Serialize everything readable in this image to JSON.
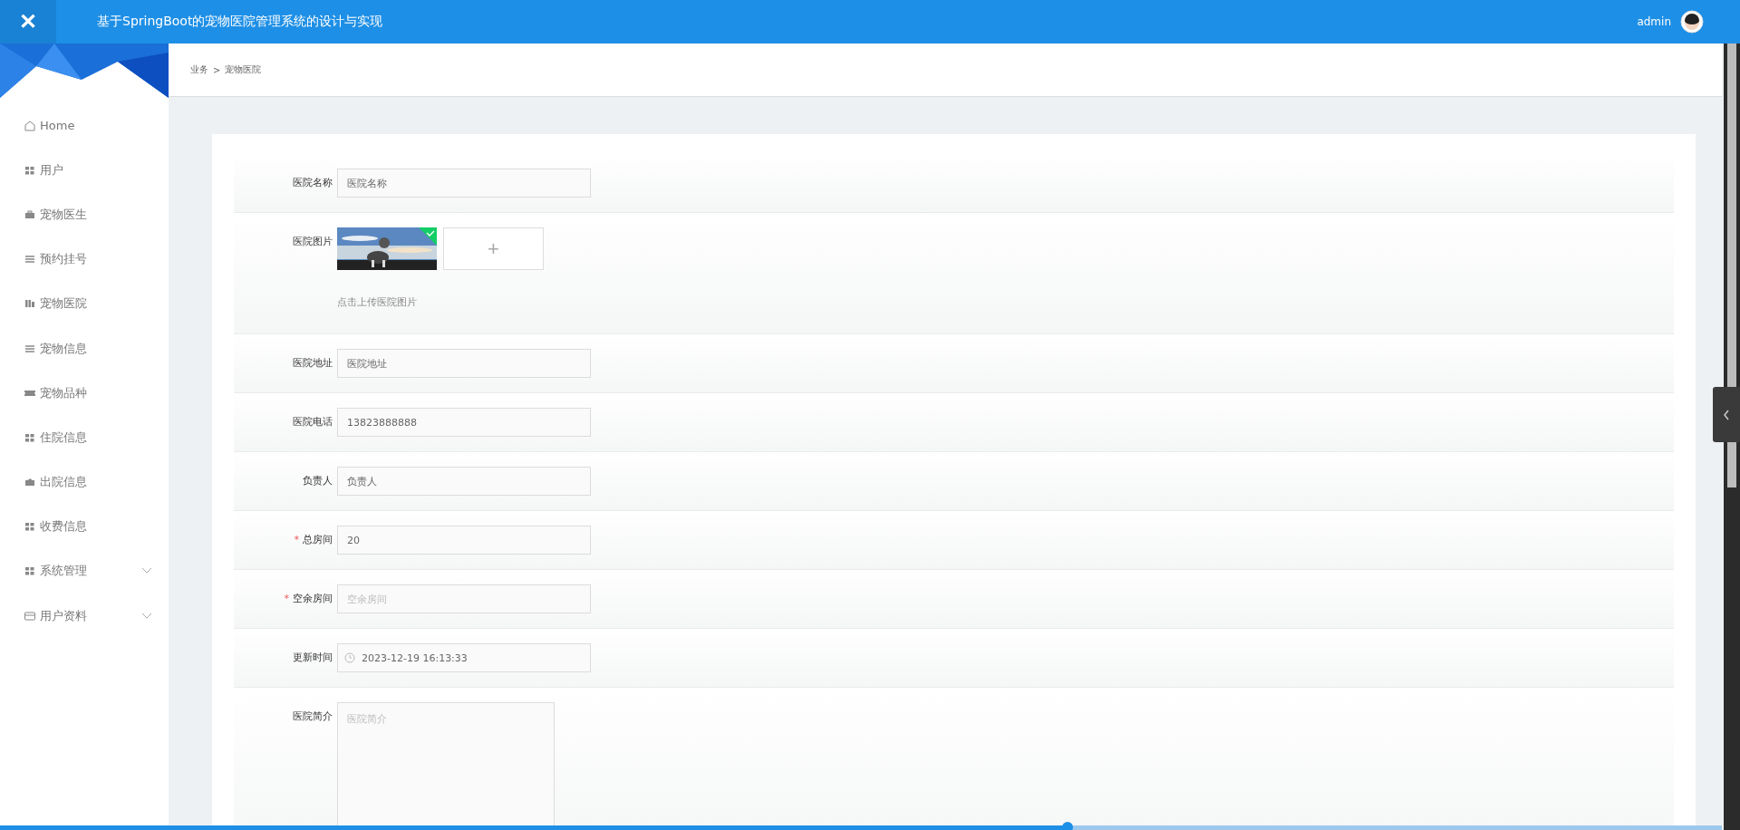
{
  "header": {
    "close_icon": "✕",
    "title": "基于SpringBoot的宠物医院管理系统的设计与实现",
    "user": "admin"
  },
  "sidebar": {
    "items": [
      {
        "label": "Home",
        "kind": "home",
        "expandable": false
      },
      {
        "label": "用户",
        "kind": "grid",
        "expandable": false
      },
      {
        "label": "宠物医生",
        "kind": "bag",
        "expandable": false
      },
      {
        "label": "预约挂号",
        "kind": "lines",
        "expandable": false
      },
      {
        "label": "宠物医院",
        "kind": "bars",
        "expandable": false
      },
      {
        "label": "宠物信息",
        "kind": "lines",
        "expandable": false
      },
      {
        "label": "宠物品种",
        "kind": "ticket",
        "expandable": false
      },
      {
        "label": "住院信息",
        "kind": "grid",
        "expandable": false
      },
      {
        "label": "出院信息",
        "kind": "wallet",
        "expandable": false
      },
      {
        "label": "收费信息",
        "kind": "grid",
        "expandable": false
      },
      {
        "label": "系统管理",
        "kind": "grid",
        "expandable": true
      },
      {
        "label": "用户资料",
        "kind": "card",
        "expandable": true
      }
    ]
  },
  "breadcrumb": [
    "业务",
    ">",
    "宠物医院"
  ],
  "form": {
    "fields": [
      {
        "kind": "text",
        "label": "医院名称",
        "value": "医院名称"
      },
      {
        "label": "医院图片",
        "add": "+",
        "hint": "点击上传医院图片"
      },
      {
        "kind": "text",
        "label": "医院地址",
        "value": "医院地址"
      },
      {
        "kind": "text",
        "label": "医院电话",
        "value": "13823888888"
      },
      {
        "kind": "text",
        "label": "负责人",
        "value": "负责人"
      },
      {
        "kind": "text",
        "label": "总房间",
        "required_mark": "*",
        "value": "20"
      },
      {
        "kind": "text",
        "label": "空余房间",
        "required_mark": "*",
        "placeholder": "空余房间"
      },
      {
        "kind": "date",
        "label": "更新时间",
        "value": "2023-12-19 16:13:33"
      },
      {
        "kind": "textarea",
        "label": "医院简介",
        "placeholder": "医院简介"
      }
    ]
  },
  "video_progress": {
    "level": 0.62
  }
}
